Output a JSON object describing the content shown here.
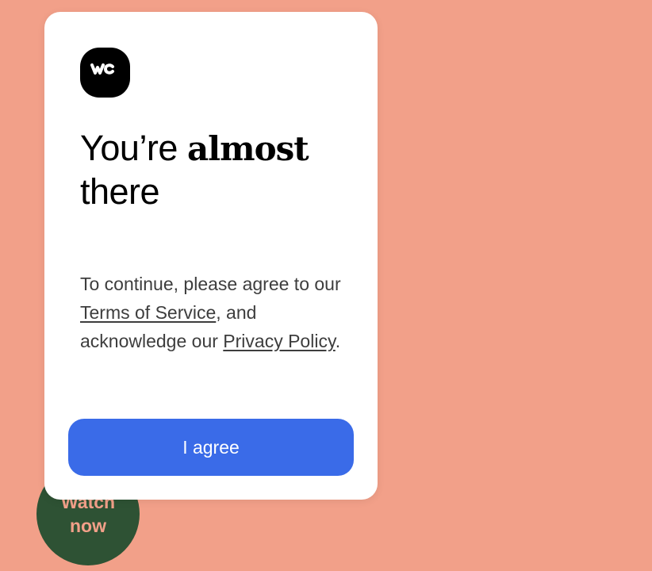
{
  "watch_badge": {
    "line1": "Watch",
    "line2": "now"
  },
  "modal": {
    "logo_icon": "we-logo-icon",
    "heading_plain": "You’re ",
    "heading_bold": "almost",
    "heading_rest": "there",
    "body_prefix": "To continue, please agree to our ",
    "terms_link": "Terms of Service",
    "body_middle": ", and acknowledge our ",
    "privacy_link": "Privacy Policy",
    "body_suffix": ".",
    "agree_label": "I agree"
  },
  "colors": {
    "background": "#f2a089",
    "button": "#3a6be8",
    "badge": "#2e5234"
  }
}
